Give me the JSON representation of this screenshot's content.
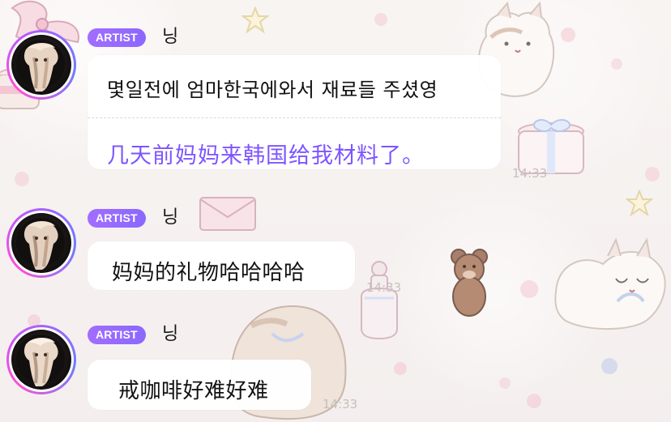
{
  "messages": [
    {
      "badge": "ARTIST",
      "sender": "닝",
      "text": "몇일전에 엄마한국에와서 재료들 주셨영",
      "translation": "几天前妈妈来韩国给我材料了。",
      "time": "14:33"
    },
    {
      "badge": "ARTIST",
      "sender": "닝",
      "text": "妈妈的礼物哈哈哈哈",
      "time": "14:33"
    },
    {
      "badge": "ARTIST",
      "sender": "닝",
      "text": "戒咖啡好难好难",
      "time": "14:33"
    }
  ]
}
